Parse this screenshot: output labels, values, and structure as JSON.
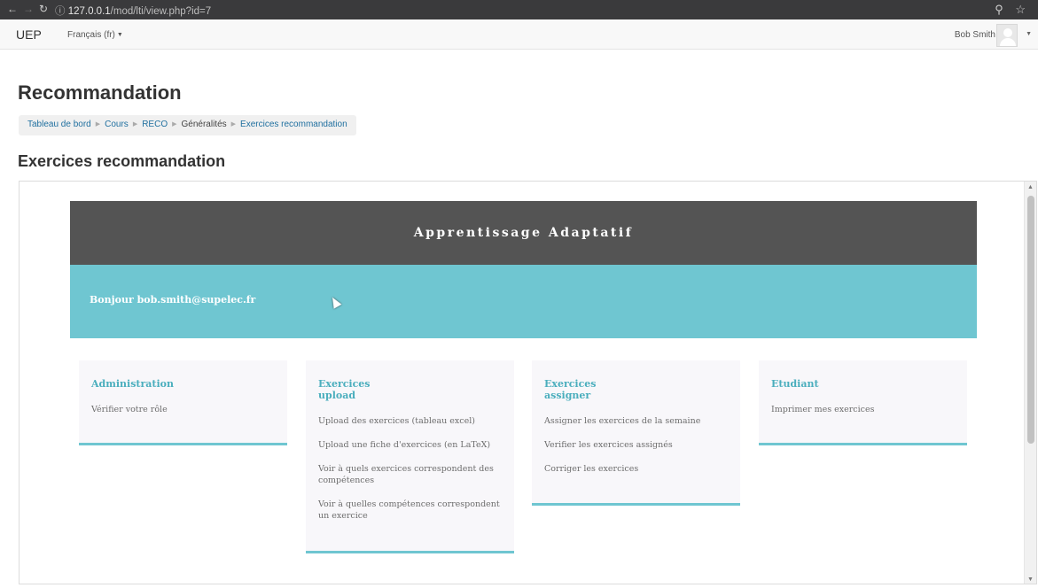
{
  "browser": {
    "back_icon": "back-arrow-icon",
    "url_host": "127.0.0.1",
    "url_path": "/mod/lti/view.php?id=7"
  },
  "navbar": {
    "brand": "UEP",
    "language": "Français (fr)",
    "user_name": "Bob Smith"
  },
  "page": {
    "title": "Recommandation",
    "breadcrumb": [
      "Tableau de bord",
      "Cours",
      "RECO",
      "Généralités",
      "Exercices recommandation"
    ],
    "section_title": "Exercices recommandation"
  },
  "app": {
    "banner": "Apprentissage Adaptatif",
    "welcome": "Bonjour bob.smith@supelec.fr",
    "accent_color": "#6fc6d1",
    "banner_color": "#545454",
    "cards": [
      {
        "title": "Administration",
        "items": [
          "Vérifier votre rôle"
        ]
      },
      {
        "title": "Exercices upload",
        "items": [
          "Upload des exercices (tableau excel)",
          "Upload une fiche d'exercices (en LaTeX)",
          "Voir à quels exercices correspondent des compétences",
          "Voir à quelles compétences correspondent un exercice"
        ]
      },
      {
        "title": "Exercices assigner",
        "items": [
          "Assigner les exercices de la semaine",
          "Verifier les exercices assignés",
          "Corriger les exercices"
        ]
      },
      {
        "title": "Etudiant",
        "items": [
          "Imprimer mes exercices"
        ]
      }
    ]
  }
}
